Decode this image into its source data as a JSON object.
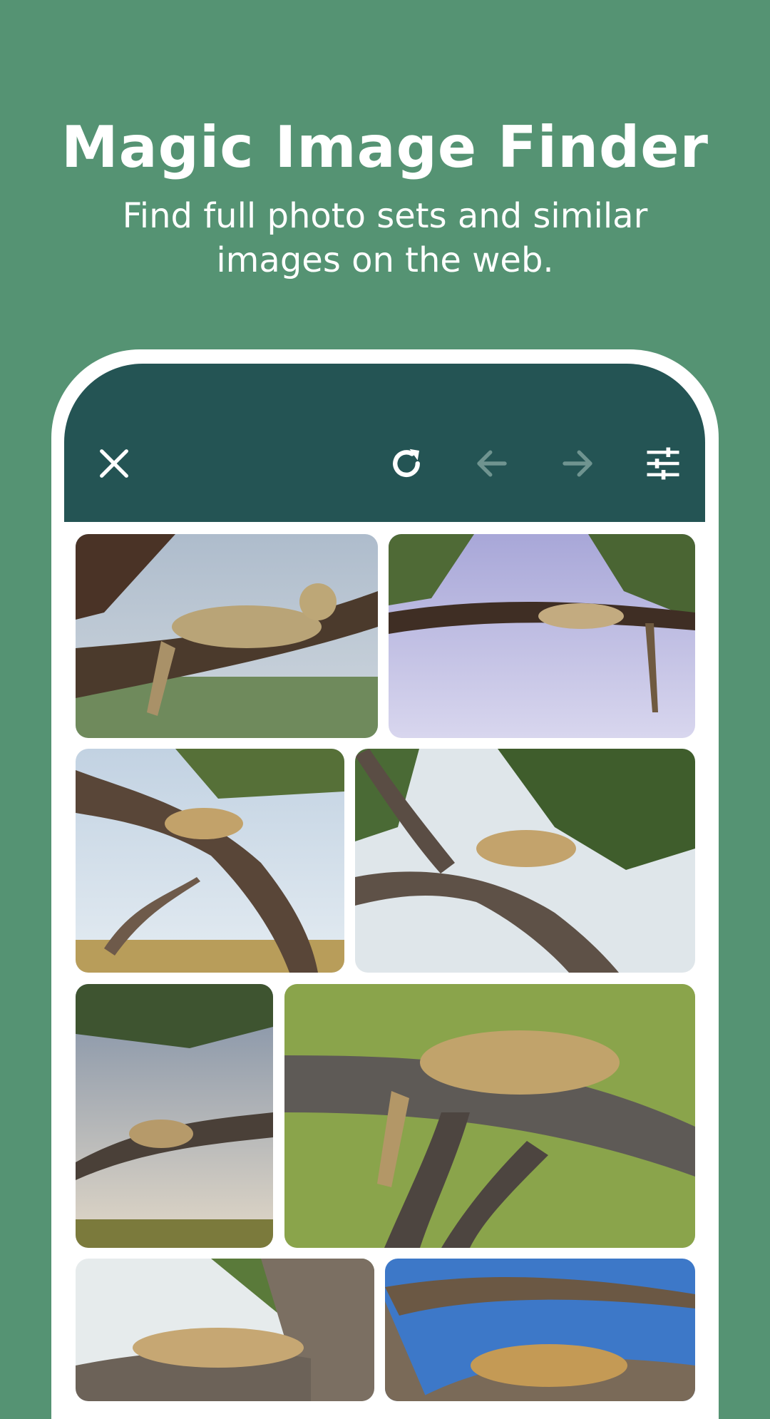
{
  "hero": {
    "title": "Magic Image Finder",
    "subtitle": "Find full photo sets and similar images on the web."
  },
  "toolbar": {
    "buttons": [
      {
        "name": "close",
        "icon": "close-icon",
        "enabled": true
      },
      {
        "name": "refresh",
        "icon": "refresh-icon",
        "enabled": true
      },
      {
        "name": "back",
        "icon": "arrow-left-icon",
        "enabled": false
      },
      {
        "name": "forward",
        "icon": "arrow-right-icon",
        "enabled": false
      },
      {
        "name": "filters",
        "icon": "sliders-icon",
        "enabled": true
      }
    ]
  },
  "theme": {
    "background": "#559373",
    "toolbar": "#245454",
    "icon_active": "#ffffff",
    "icon_disabled": "#6f9490"
  },
  "results": {
    "images": [
      {
        "subject": "leopard resting on tree branch"
      },
      {
        "subject": "leopard lying on branch against purple sky"
      },
      {
        "subject": "leopard on curved trunk"
      },
      {
        "subject": "leopard yawning on branch"
      },
      {
        "subject": "leopard on acacia branch"
      },
      {
        "subject": "leopard sleeping on mossy branch"
      },
      {
        "subject": "leopard lounging on rock"
      },
      {
        "subject": "leopard on branch against blue sky"
      }
    ]
  }
}
